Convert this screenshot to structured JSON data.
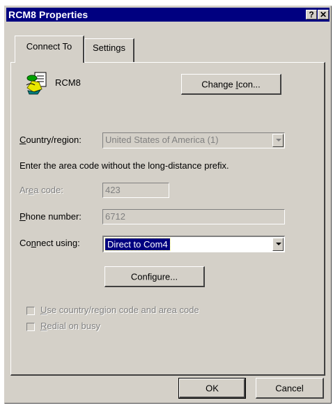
{
  "window": {
    "title": "RCM8 Properties",
    "help_btn": "?",
    "close_btn": "✕"
  },
  "tabs": [
    {
      "label": "Connect To",
      "active": true
    },
    {
      "label": "Settings",
      "active": false
    }
  ],
  "connection": {
    "name": "RCM8",
    "change_icon_pre": "Change ",
    "change_icon_u": "I",
    "change_icon_post": "con..."
  },
  "country": {
    "label_u": "C",
    "label_rest": "ountry/region:",
    "value": "United States of America (1)"
  },
  "instruction": "Enter the area code without the long-distance prefix.",
  "area_code": {
    "label_pre": "Ar",
    "label_u": "e",
    "label_post": "a code:",
    "value": "423"
  },
  "phone": {
    "label_u": "P",
    "label_rest": "hone number:",
    "value": "6712"
  },
  "connect_using": {
    "label_pre": "Co",
    "label_u": "n",
    "label_post": "nect using:",
    "value": "Direct to Com4"
  },
  "configure": {
    "pre": "Confi",
    "u": "g",
    "post": "ure..."
  },
  "checkboxes": [
    {
      "u": "U",
      "rest": "se country/region code and area code",
      "checked": false
    },
    {
      "u": "R",
      "rest": "edial on busy",
      "checked": false
    }
  ],
  "buttons": {
    "ok": "OK",
    "cancel": "Cancel"
  }
}
